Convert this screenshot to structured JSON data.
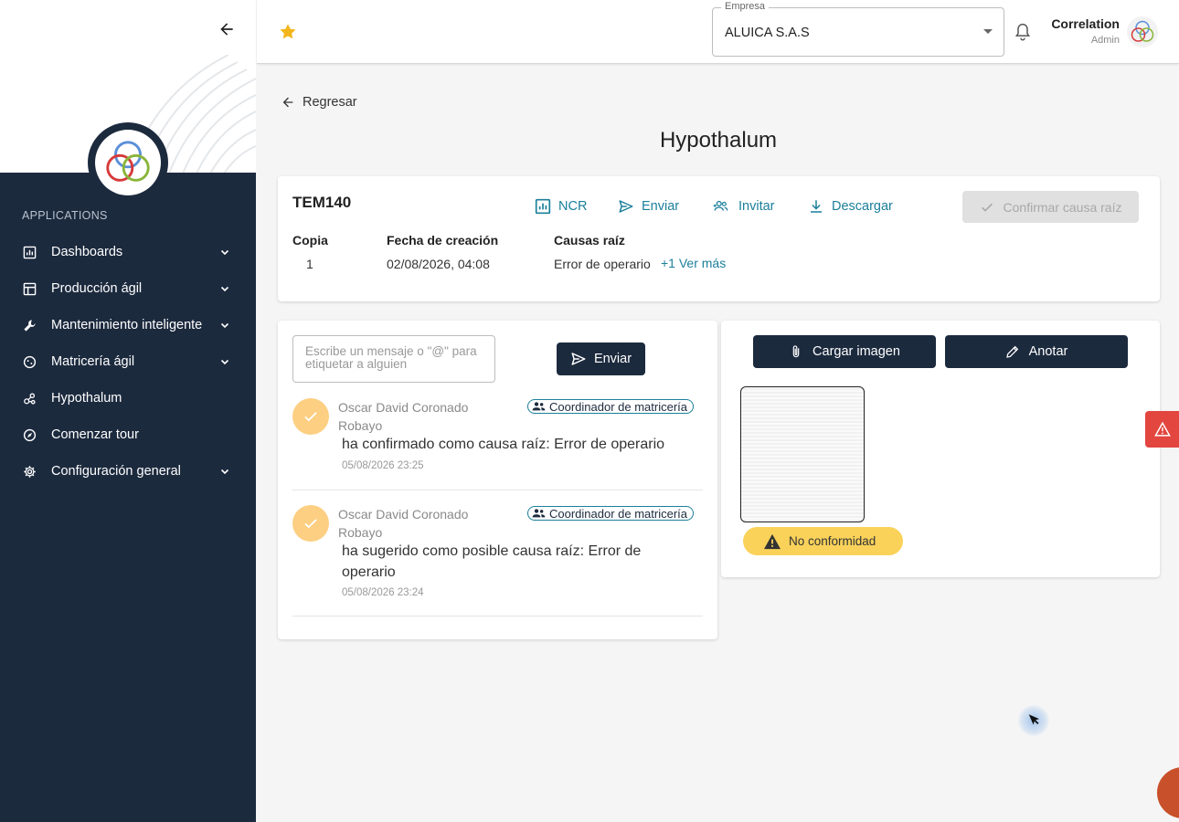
{
  "sidebar": {
    "section_label": "APPLICATIONS",
    "items": [
      {
        "label": "Dashboards",
        "icon": "chart-icon",
        "expandable": true
      },
      {
        "label": "Producción ágil",
        "icon": "table-icon",
        "expandable": true
      },
      {
        "label": "Mantenimiento inteligente",
        "icon": "wrench-icon",
        "expandable": true
      },
      {
        "label": "Matricería ágil",
        "icon": "globe-icon",
        "expandable": true
      },
      {
        "label": "Hypothalum",
        "icon": "molecule-icon",
        "expandable": false
      },
      {
        "label": "Comenzar tour",
        "icon": "compass-icon",
        "expandable": false
      },
      {
        "label": "Configuración general",
        "icon": "gear-icon",
        "expandable": true
      }
    ]
  },
  "header": {
    "company_legend": "Empresa",
    "company_value": "ALUICA S.A.S",
    "user_name": "Correlation",
    "user_role": "Admin"
  },
  "main": {
    "back_label": "Regresar",
    "title": "Hypothalum",
    "info": {
      "code": "TEM140",
      "actions": {
        "ncr": "NCR",
        "send": "Enviar",
        "invite": "Invitar",
        "download": "Descargar"
      },
      "confirm_label": "Confirmar causa raíz",
      "copy_label": "Copia",
      "copy_value": "1",
      "date_label": "Fecha de creación",
      "date_value": "02/08/2026, 04:08",
      "causes_label": "Causas raíz",
      "causes_value": "Error de operario",
      "see_more": "+1 Ver más"
    },
    "chat": {
      "placeholder": "Escribe un mensaje o \"@\" para etiquetar a alguien",
      "send_label": "Enviar",
      "messages": [
        {
          "author": "Oscar David Coronado Robayo",
          "role": "Coordinador de matricería",
          "text": "ha confirmado como causa raíz: Error de operario",
          "time": "05/08/2026 23:25"
        },
        {
          "author": "Oscar David Coronado Robayo",
          "role": "Coordinador de matricería",
          "text": "ha sugerido como posible causa raíz: Error de operario",
          "time": "05/08/2026 23:24"
        }
      ]
    },
    "images": {
      "upload_label": "Cargar imagen",
      "annotate_label": "Anotar",
      "badge_label": "No conformidad"
    }
  },
  "colors": {
    "sidebar_bg": "#1c2a3e",
    "accent": "#1b7f9b",
    "badge_yellow": "#fad25a",
    "check_orange": "#fdcf82",
    "alert_red": "#e3453f"
  }
}
